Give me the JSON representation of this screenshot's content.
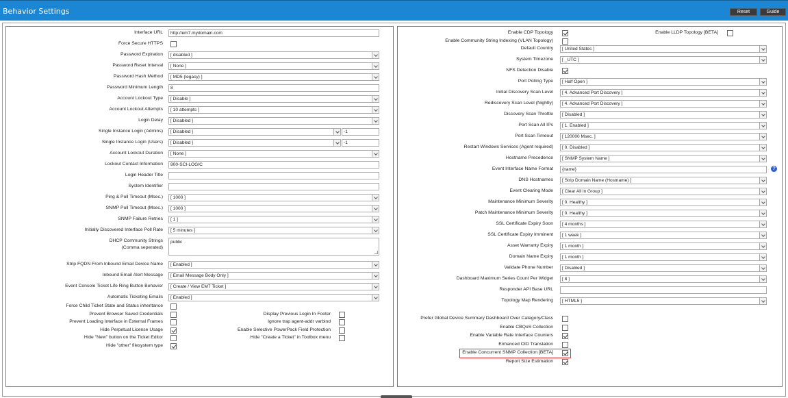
{
  "header": {
    "title": "Behavior Settings",
    "reset_label": "Reset",
    "guide_label": "Guide"
  },
  "left": {
    "fields": [
      {
        "label": "Interface URL",
        "type": "text",
        "value": "http://em7.mydomain.com"
      },
      {
        "label": "Force Secure HTTPS",
        "type": "checkbox",
        "checked": false
      },
      {
        "label": "Password Expiration",
        "type": "select",
        "value": "[ disabled ]"
      },
      {
        "label": "Password Reset Interval",
        "type": "select",
        "value": "[ None ]"
      },
      {
        "label": "Password Hash Method",
        "type": "select",
        "value": "[ MD5 (legacy) ]"
      },
      {
        "label": "Password Minimum Length",
        "type": "text",
        "value": "8"
      },
      {
        "label": "Account Lockout Type",
        "type": "select",
        "value": "[ Disable ]"
      },
      {
        "label": "Account Lockout Attempts",
        "type": "select",
        "value": "[ 10 attempts ]"
      },
      {
        "label": "Login Delay",
        "type": "select",
        "value": "[ Disabled ]"
      },
      {
        "label": "Single Instance Login (Admins)",
        "type": "select-short",
        "value": "[ Disabled ]",
        "extra": "-1"
      },
      {
        "label": "Single Instance Login (Users)",
        "type": "select-short",
        "value": "[ Disabled ]",
        "extra": "-1"
      },
      {
        "label": "Account Lockout Duration",
        "type": "select",
        "value": "[ None ]"
      },
      {
        "label": "Lockout Contact Information",
        "type": "text",
        "value": "800-SCI-LOGIC"
      },
      {
        "label": "Login Header Title",
        "type": "text",
        "value": ""
      },
      {
        "label": "System Identifier",
        "type": "text",
        "value": ""
      },
      {
        "label": "Ping & Poll Timeout (Msec.)",
        "type": "select",
        "value": "[ 1000 ]"
      },
      {
        "label": "SNMP Poll Timeout (Msec.)",
        "type": "select",
        "value": "[ 1000 ]"
      },
      {
        "label": "SNMP Failure Retries",
        "type": "select",
        "value": "[ 1 ]"
      },
      {
        "label": "Initially Discovered Interface Poll Rate",
        "type": "select",
        "value": "[ 5 minutes ]"
      },
      {
        "label": "DHCP Community Strings",
        "label2": "(Comma seperated)",
        "type": "textarea",
        "value": "public"
      },
      {
        "label": "Strip FQDN From Inbound Email Device Name",
        "type": "select",
        "value": "[ Enabled ]"
      },
      {
        "label": "Inbound Email Alert Message",
        "type": "select",
        "value": "[ Email Message Body Only ]"
      },
      {
        "label": "Event Console Ticket Life Ring Button Behavior",
        "type": "select",
        "value": "[ Create / View EM7 Ticket ]"
      },
      {
        "label": "Automatic Ticketing Emails",
        "type": "select",
        "value": "[ Enabled ]"
      }
    ],
    "checkboxes_left": [
      {
        "label": "Force Child Ticket State and Status inheritance",
        "checked": false
      },
      {
        "label": "Prevent Browser Saved Credentials",
        "checked": false
      },
      {
        "label": "Prevent Loading Interface in External Frames",
        "checked": false
      },
      {
        "label": "Hide Perpetual License Usage",
        "checked": true
      },
      {
        "label": "Hide \"New\" button on the Ticket Editor",
        "checked": false
      },
      {
        "label": "Hide \"other\" filesystem type",
        "checked": true
      }
    ],
    "checkboxes_right": [
      {
        "label": "Display Previous Login In Footer",
        "checked": false
      },
      {
        "label": "Ignore trap agent-addr varbind",
        "checked": false
      },
      {
        "label": "Enable Selective PowerPack Field Protection",
        "checked": false
      },
      {
        "label": "Hide \"Create a Ticket\" in Toolbox menu",
        "checked": false
      }
    ]
  },
  "right": {
    "cdp_label": "Enable CDP Topology",
    "cdp_checked": true,
    "lldp_label": "Enable LLDP Topology [BETA]",
    "lldp_checked": false,
    "fields": [
      {
        "label": "Enable Community String Indexing (VLAN Topology)",
        "type": "checkbox",
        "checked": false
      },
      {
        "label": "Default Country",
        "type": "select",
        "value": "[ United States ]"
      },
      {
        "label": "System Timezone",
        "type": "select",
        "value": "[ _UTC ]"
      },
      {
        "label": "NFS Detection Disable",
        "type": "checkbox",
        "checked": true
      },
      {
        "label": "Port Polling Type",
        "type": "select",
        "value": "[ Half Open ]"
      },
      {
        "label": "Initial Discovery Scan Level",
        "type": "select",
        "value": "[ 4. Advanced Port Discovery ]"
      },
      {
        "label": "Rediscovery Scan Level (Nightly)",
        "type": "select",
        "value": "[ 4. Advanced Port Discovery ]"
      },
      {
        "label": "Discovery Scan Throttle",
        "type": "select",
        "value": "[ Disabled ]"
      },
      {
        "label": "Port Scan All IPs",
        "type": "select",
        "value": "[ 1. Enabled ]"
      },
      {
        "label": "Port Scan Timeout",
        "type": "select",
        "value": "[ 120000 Msec. ]"
      },
      {
        "label": "Restart Windows Services (Agent required)",
        "type": "select",
        "value": "[ 0. Disabled ]"
      },
      {
        "label": "Hostname Precedence",
        "type": "select",
        "value": "[ SNMP System Name ]"
      },
      {
        "label": "Event Interface Name Format",
        "type": "text-help",
        "value": "{name}"
      },
      {
        "label": "DNS Hostnames",
        "type": "select",
        "value": "[ Strip Domain Name (Hostname) ]"
      },
      {
        "label": "Event Clearing Mode",
        "type": "select",
        "value": "[ Clear All in Group ]"
      },
      {
        "label": "Maintenance Minimum Severity",
        "type": "select",
        "value": "[ 0. Healthy ]"
      },
      {
        "label": "Patch Maintenance Minimum Severity",
        "type": "select",
        "value": "[ 0. Healthy ]"
      },
      {
        "label": "SSL Certificate Expiry Soon",
        "type": "select",
        "value": "[ 4 months ]"
      },
      {
        "label": "SSL Certificate Expiry Imminent",
        "type": "select",
        "value": "[ 1 week ]"
      },
      {
        "label": "Asset Warranty Expiry",
        "type": "select",
        "value": "[ 1 month ]"
      },
      {
        "label": "Domain Name Expiry",
        "type": "select",
        "value": "[ 1 month ]"
      },
      {
        "label": "Validate Phone Number",
        "type": "select",
        "value": "[ Disabled ]"
      },
      {
        "label": "Dashboard Maximum Series Count Per Widget",
        "type": "select",
        "value": "[ 8 ]"
      },
      {
        "label": "Responder API Base URL",
        "type": "text",
        "value": ""
      },
      {
        "label": "Topology Map Rendering",
        "type": "select",
        "value": "[ HTML5 ]"
      }
    ],
    "checkboxes": [
      {
        "label": "Prefer Global Device Summary Dashboard Over Category/Class",
        "checked": false
      },
      {
        "label": "Enable CBQoS Collection",
        "checked": false
      },
      {
        "label": "Enable Variable Rate Interface Counters",
        "checked": true
      },
      {
        "label": "Enhanced OID Translation",
        "checked": false
      },
      {
        "label": "Enable Concurrent SNMP Collection [BETA]",
        "checked": true
      },
      {
        "label": "Report Size Estimation",
        "checked": true
      }
    ]
  },
  "help_icon_text": "?",
  "colors": {
    "header": "#1a86d4",
    "highlight": "#e03030"
  }
}
